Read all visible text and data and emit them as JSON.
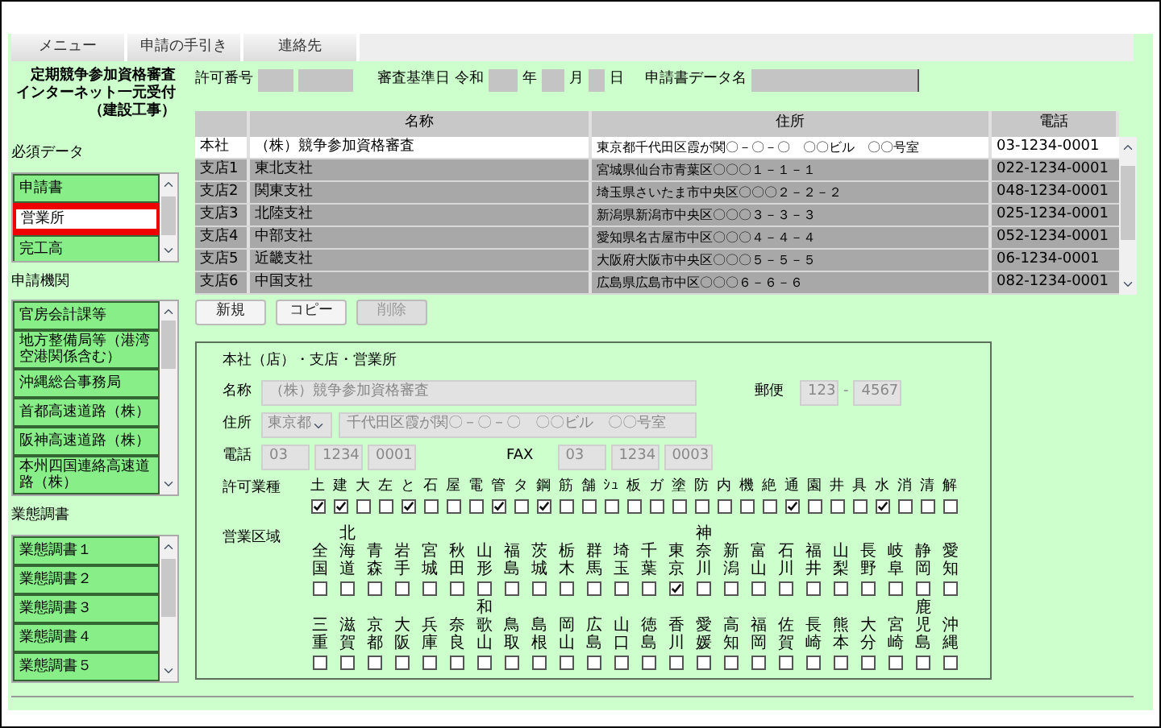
{
  "menu": [
    {
      "label": "メニュー"
    },
    {
      "label": "申請の手引き"
    },
    {
      "label": "連絡先"
    }
  ],
  "title_lines": [
    "定期競争参加資格審査",
    "インターネット一元受付",
    "（建設工事）"
  ],
  "sections": [
    {
      "label": "必須データ",
      "items": [
        {
          "label": "申請書",
          "selected": false
        },
        {
          "label": "営業所",
          "selected": true
        },
        {
          "label": "完工高",
          "selected": false
        }
      ]
    },
    {
      "label": "申請機関",
      "items": [
        {
          "label": "官房会計課等",
          "selected": false
        },
        {
          "label": "地方整備局等（港湾空港関係含む）",
          "selected": false
        },
        {
          "label": "沖縄総合事務局",
          "selected": false
        },
        {
          "label": "首都高速道路（株）",
          "selected": false
        },
        {
          "label": "阪神高速道路（株）",
          "selected": false
        },
        {
          "label": "本州四国連絡高速道路（株）",
          "selected": false
        }
      ]
    },
    {
      "label": "業態調書",
      "items": [
        {
          "label": "業態調書１",
          "selected": false
        },
        {
          "label": "業態調書２",
          "selected": false
        },
        {
          "label": "業態調書３",
          "selected": false
        },
        {
          "label": "業態調書４",
          "selected": false
        },
        {
          "label": "業態調書５",
          "selected": false
        }
      ]
    }
  ],
  "header": {
    "permit_label": "許可番号",
    "date_label": "審査基準日",
    "era": "令和",
    "year_unit": "年",
    "month_unit": "月",
    "day_unit": "日",
    "data_name_label": "申請書データ名"
  },
  "table": {
    "columns": [
      "名称",
      "住所",
      "電話"
    ],
    "rows": [
      {
        "type": "本社",
        "name": "（株）競争参加資格審査",
        "address": "東京都千代田区霞が関〇－〇－〇　〇〇ビル　〇〇号室",
        "phone": "03-1234-0001",
        "selected": true
      },
      {
        "type": "支店1",
        "name": "東北支社",
        "address": "宮城県仙台市青葉区〇〇〇１－１－１",
        "phone": "022-1234-0001",
        "selected": false
      },
      {
        "type": "支店2",
        "name": "関東支社",
        "address": "埼玉県さいたま市中央区〇〇〇２－２－２",
        "phone": "048-1234-0001",
        "selected": false
      },
      {
        "type": "支店3",
        "name": "北陸支社",
        "address": "新潟県新潟市中央区〇〇〇３－３－３",
        "phone": "025-1234-0001",
        "selected": false
      },
      {
        "type": "支店4",
        "name": "中部支社",
        "address": "愛知県名古屋市中区〇〇〇４－４－４",
        "phone": "052-1234-0001",
        "selected": false
      },
      {
        "type": "支店5",
        "name": "近畿支社",
        "address": "大阪府大阪市中央区〇〇〇５－５－５",
        "phone": "06-1234-0001",
        "selected": false
      },
      {
        "type": "支店6",
        "name": "中国支社",
        "address": "広島県広島市中区〇〇〇６－６－６",
        "phone": "082-1234-0001",
        "selected": false
      }
    ]
  },
  "buttons": [
    {
      "label": "新規",
      "disabled": false
    },
    {
      "label": "コピー",
      "disabled": false
    },
    {
      "label": "削除",
      "disabled": true
    }
  ],
  "form": {
    "legend": "本社（店）・支店・営業所",
    "name_label": "名称",
    "name_value": "（株）競争参加資格審査",
    "postal_label": "郵便",
    "postal_1": "123",
    "postal_sep": "-",
    "postal_2": "4567",
    "address_label": "住所",
    "prefecture": "東京都",
    "address_value": "千代田区霞が関〇－〇－〇　〇〇ビル　〇〇号室",
    "phone_label": "電話",
    "phone": [
      "03",
      "1234",
      "0001"
    ],
    "fax_label": "FAX",
    "fax": [
      "03",
      "1234",
      "0003"
    ],
    "license_label": "許可業種",
    "licenses": [
      {
        "label": "土",
        "checked": true
      },
      {
        "label": "建",
        "checked": true
      },
      {
        "label": "大",
        "checked": false
      },
      {
        "label": "左",
        "checked": false
      },
      {
        "label": "と",
        "checked": true
      },
      {
        "label": "石",
        "checked": false
      },
      {
        "label": "屋",
        "checked": false
      },
      {
        "label": "電",
        "checked": false
      },
      {
        "label": "管",
        "checked": true
      },
      {
        "label": "タ",
        "checked": false
      },
      {
        "label": "鋼",
        "checked": true
      },
      {
        "label": "筋",
        "checked": false
      },
      {
        "label": "舗",
        "checked": false
      },
      {
        "label": "ｼｭ",
        "checked": false
      },
      {
        "label": "板",
        "checked": false
      },
      {
        "label": "ガ",
        "checked": false
      },
      {
        "label": "塗",
        "checked": false
      },
      {
        "label": "防",
        "checked": false
      },
      {
        "label": "内",
        "checked": false
      },
      {
        "label": "機",
        "checked": false
      },
      {
        "label": "絶",
        "checked": false
      },
      {
        "label": "通",
        "checked": true
      },
      {
        "label": "園",
        "checked": false
      },
      {
        "label": "井",
        "checked": false
      },
      {
        "label": "具",
        "checked": false
      },
      {
        "label": "水",
        "checked": true
      },
      {
        "label": "消",
        "checked": false
      },
      {
        "label": "清",
        "checked": false
      },
      {
        "label": "解",
        "checked": false
      }
    ],
    "area_label": "営業区域",
    "area_rows": [
      [
        {
          "label": "全国",
          "checked": false
        },
        {
          "label": "北海道",
          "checked": false
        },
        {
          "label": "青森",
          "checked": false
        },
        {
          "label": "岩手",
          "checked": false
        },
        {
          "label": "宮城",
          "checked": false
        },
        {
          "label": "秋田",
          "checked": false
        },
        {
          "label": "山形",
          "checked": false
        },
        {
          "label": "福島",
          "checked": false
        },
        {
          "label": "茨城",
          "checked": false
        },
        {
          "label": "栃木",
          "checked": false
        },
        {
          "label": "群馬",
          "checked": false
        },
        {
          "label": "埼玉",
          "checked": false
        },
        {
          "label": "千葉",
          "checked": false
        },
        {
          "label": "東京",
          "checked": true
        },
        {
          "label": "神奈川",
          "checked": false
        },
        {
          "label": "新潟",
          "checked": false
        },
        {
          "label": "富山",
          "checked": false
        },
        {
          "label": "石川",
          "checked": false
        },
        {
          "label": "福井",
          "checked": false
        },
        {
          "label": "山梨",
          "checked": false
        },
        {
          "label": "長野",
          "checked": false
        },
        {
          "label": "岐阜",
          "checked": false
        },
        {
          "label": "静岡",
          "checked": false
        },
        {
          "label": "愛知",
          "checked": false
        }
      ],
      [
        {
          "label": "三重",
          "checked": false
        },
        {
          "label": "滋賀",
          "checked": false
        },
        {
          "label": "京都",
          "checked": false
        },
        {
          "label": "大阪",
          "checked": false
        },
        {
          "label": "兵庫",
          "checked": false
        },
        {
          "label": "奈良",
          "checked": false
        },
        {
          "label": "和歌山",
          "checked": false
        },
        {
          "label": "鳥取",
          "checked": false
        },
        {
          "label": "島根",
          "checked": false
        },
        {
          "label": "岡山",
          "checked": false
        },
        {
          "label": "広島",
          "checked": false
        },
        {
          "label": "山口",
          "checked": false
        },
        {
          "label": "徳島",
          "checked": false
        },
        {
          "label": "香川",
          "checked": false
        },
        {
          "label": "愛媛",
          "checked": false
        },
        {
          "label": "高知",
          "checked": false
        },
        {
          "label": "福岡",
          "checked": false
        },
        {
          "label": "佐賀",
          "checked": false
        },
        {
          "label": "長崎",
          "checked": false
        },
        {
          "label": "熊本",
          "checked": false
        },
        {
          "label": "大分",
          "checked": false
        },
        {
          "label": "宮崎",
          "checked": false
        },
        {
          "label": "鹿児島",
          "checked": false
        },
        {
          "label": "沖縄",
          "checked": false
        }
      ]
    ]
  }
}
